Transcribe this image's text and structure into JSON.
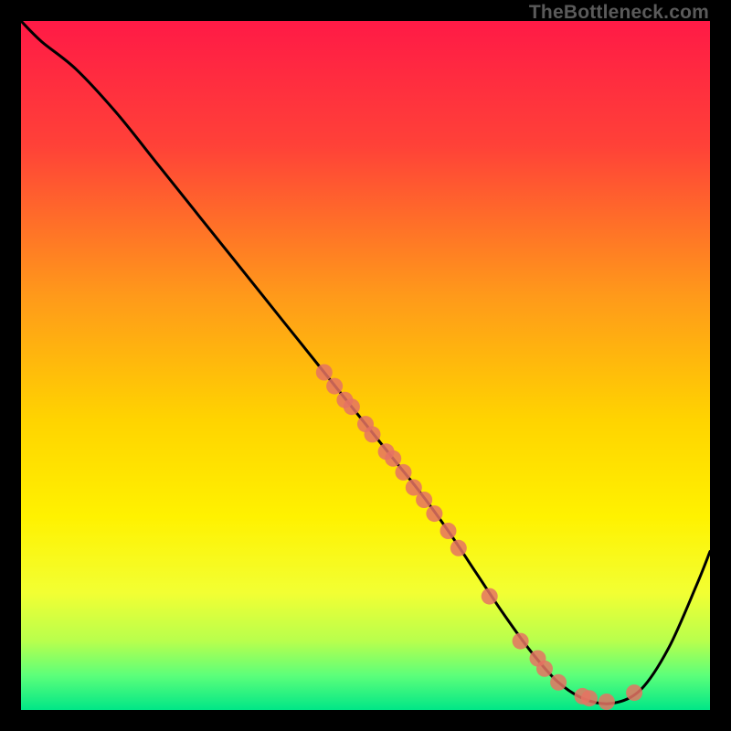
{
  "watermark": "TheBottleneck.com",
  "chart_data": {
    "type": "line",
    "title": "",
    "xlabel": "",
    "ylabel": "",
    "xlim": [
      0,
      100
    ],
    "ylim": [
      0,
      100
    ],
    "grid": false,
    "background": "rainbow-gradient",
    "series": [
      {
        "name": "bottleneck-curve",
        "x": [
          0,
          3,
          8,
          14,
          20,
          26,
          32,
          38,
          44,
          50,
          54,
          58,
          62,
          66,
          70,
          74,
          78,
          82,
          86,
          90,
          94,
          98,
          100
        ],
        "y": [
          100,
          97,
          93,
          86.5,
          79,
          71.5,
          64,
          56.5,
          49,
          41.5,
          36.5,
          31.5,
          26,
          20,
          14,
          8.5,
          4,
          1.5,
          1,
          3,
          9,
          18,
          23
        ]
      }
    ],
    "scatter": [
      {
        "name": "highlighted-points",
        "x": [
          44,
          45.5,
          47,
          48,
          50,
          51,
          53,
          54,
          55.5,
          57,
          58.5,
          60,
          62,
          63.5,
          68,
          72.5,
          75,
          76,
          78,
          81.5,
          82.5,
          85,
          89
        ],
        "y": [
          49,
          47,
          45,
          44,
          41.5,
          40,
          37.5,
          36.5,
          34.5,
          32.3,
          30.5,
          28.5,
          26,
          23.5,
          16.5,
          10,
          7.5,
          6,
          4,
          2,
          1.7,
          1.2,
          2.5
        ],
        "marker_color": "#e57363",
        "marker_size": 10
      }
    ],
    "gradient_stops": [
      {
        "offset": 0.0,
        "color": "#ff1a46"
      },
      {
        "offset": 0.18,
        "color": "#ff4138"
      },
      {
        "offset": 0.4,
        "color": "#ff9a1a"
      },
      {
        "offset": 0.58,
        "color": "#ffd400"
      },
      {
        "offset": 0.72,
        "color": "#fff200"
      },
      {
        "offset": 0.83,
        "color": "#f2ff33"
      },
      {
        "offset": 0.9,
        "color": "#b8ff4d"
      },
      {
        "offset": 0.95,
        "color": "#5cff7a"
      },
      {
        "offset": 1.0,
        "color": "#00e687"
      }
    ]
  }
}
